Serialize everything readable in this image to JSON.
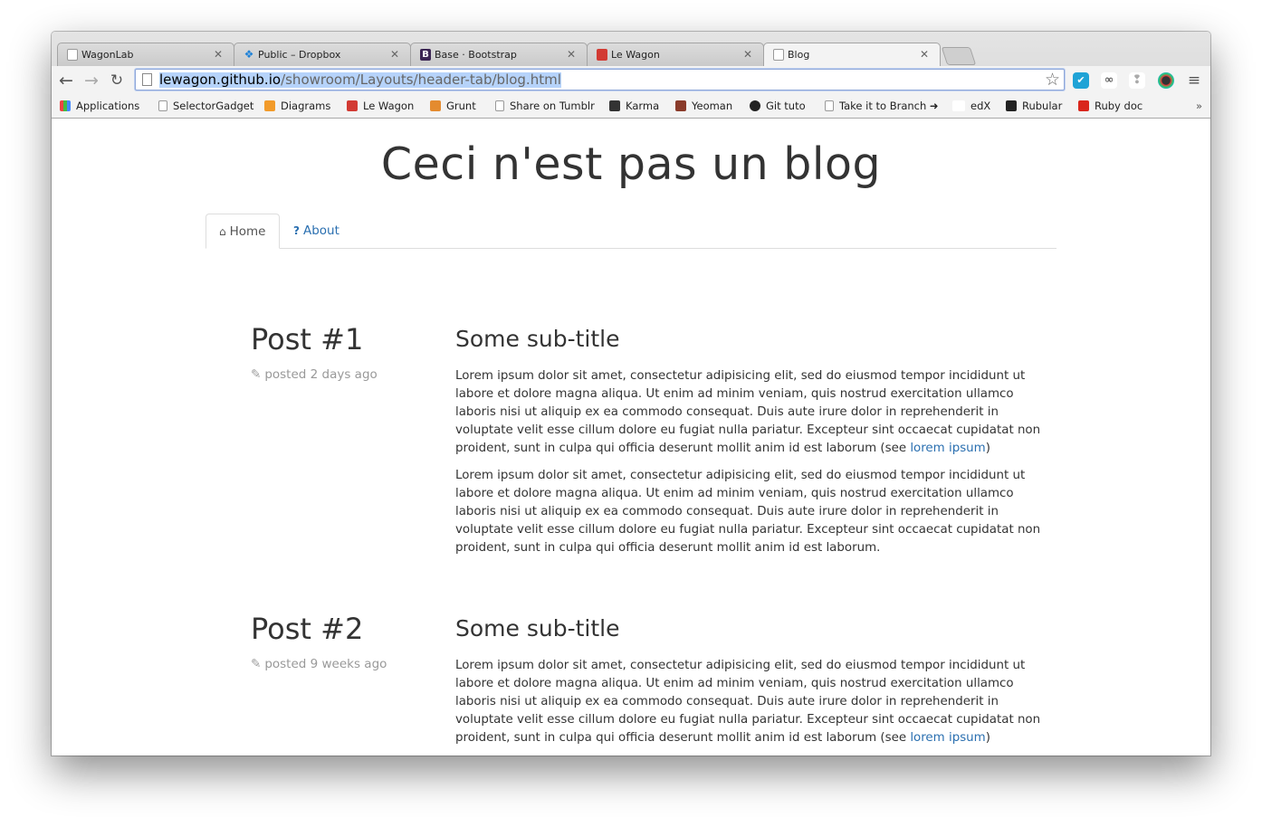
{
  "browser": {
    "tabs": [
      {
        "title": "WagonLab",
        "icon": "page-icon"
      },
      {
        "title": "Public – Dropbox",
        "icon": "dropbox-icon"
      },
      {
        "title": "Base · Bootstrap",
        "icon": "bootstrap-icon",
        "glyph": "B"
      },
      {
        "title": "Le Wagon",
        "icon": "lewagon-icon"
      },
      {
        "title": "Blog",
        "icon": "page-icon"
      }
    ],
    "url_host": "lewagon.github.io",
    "url_path": "/showroom/Layouts/header-tab/blog.html",
    "bookmarks": [
      {
        "label": "Applications"
      },
      {
        "label": "SelectorGadget"
      },
      {
        "label": "Diagrams"
      },
      {
        "label": "Le Wagon"
      },
      {
        "label": "Grunt"
      },
      {
        "label": "Share on Tumblr"
      },
      {
        "label": "Karma"
      },
      {
        "label": "Yeoman"
      },
      {
        "label": "Git tuto"
      },
      {
        "label": "Take it to Branch ➜"
      },
      {
        "label": "edX"
      },
      {
        "label": "Rubular"
      },
      {
        "label": "Ruby doc"
      }
    ],
    "bookmarks_overflow": "»"
  },
  "page": {
    "site_title": "Ceci n'est pas un blog",
    "nav": [
      {
        "label": "Home",
        "icon": "home-icon"
      },
      {
        "label": "About",
        "icon": "question-icon"
      }
    ],
    "posts": [
      {
        "title": "Post #1",
        "meta": "posted 2 days ago",
        "subtitle": "Some sub-title",
        "para1": "Lorem ipsum dolor sit amet, consectetur adipisicing elit, sed do eiusmod tempor incididunt ut labore et dolore magna aliqua. Ut enim ad minim veniam, quis nostrud exercitation ullamco laboris nisi ut aliquip ex ea commodo consequat. Duis aute irure dolor in reprehenderit in voluptate velit esse cillum dolore eu fugiat nulla pariatur. Excepteur sint occaecat cupidatat non proident, sunt in culpa qui officia deserunt mollit anim id est laborum (see ",
        "link": "lorem ipsum",
        "para1_end": ")",
        "para2": "Lorem ipsum dolor sit amet, consectetur adipisicing elit, sed do eiusmod tempor incididunt ut labore et dolore magna aliqua. Ut enim ad minim veniam, quis nostrud exercitation ullamco laboris nisi ut aliquip ex ea commodo consequat. Duis aute irure dolor in reprehenderit in voluptate velit esse cillum dolore eu fugiat nulla pariatur. Excepteur sint occaecat cupidatat non proident, sunt in culpa qui officia deserunt mollit anim id est laborum."
      },
      {
        "title": "Post #2",
        "meta": "posted 9 weeks ago",
        "subtitle": "Some sub-title",
        "para1": "Lorem ipsum dolor sit amet, consectetur adipisicing elit, sed do eiusmod tempor incididunt ut labore et dolore magna aliqua. Ut enim ad minim veniam, quis nostrud exercitation ullamco laboris nisi ut aliquip ex ea commodo consequat. Duis aute irure dolor in reprehenderit in voluptate velit esse cillum dolore eu fugiat nulla pariatur. Excepteur sint occaecat cupidatat non proident, sunt in culpa qui officia deserunt mollit anim id est laborum (see ",
        "link": "lorem ipsum",
        "para1_end": ")"
      }
    ]
  },
  "colors": {
    "link": "#2a6fb0",
    "muted": "#999999",
    "text": "#333333"
  }
}
